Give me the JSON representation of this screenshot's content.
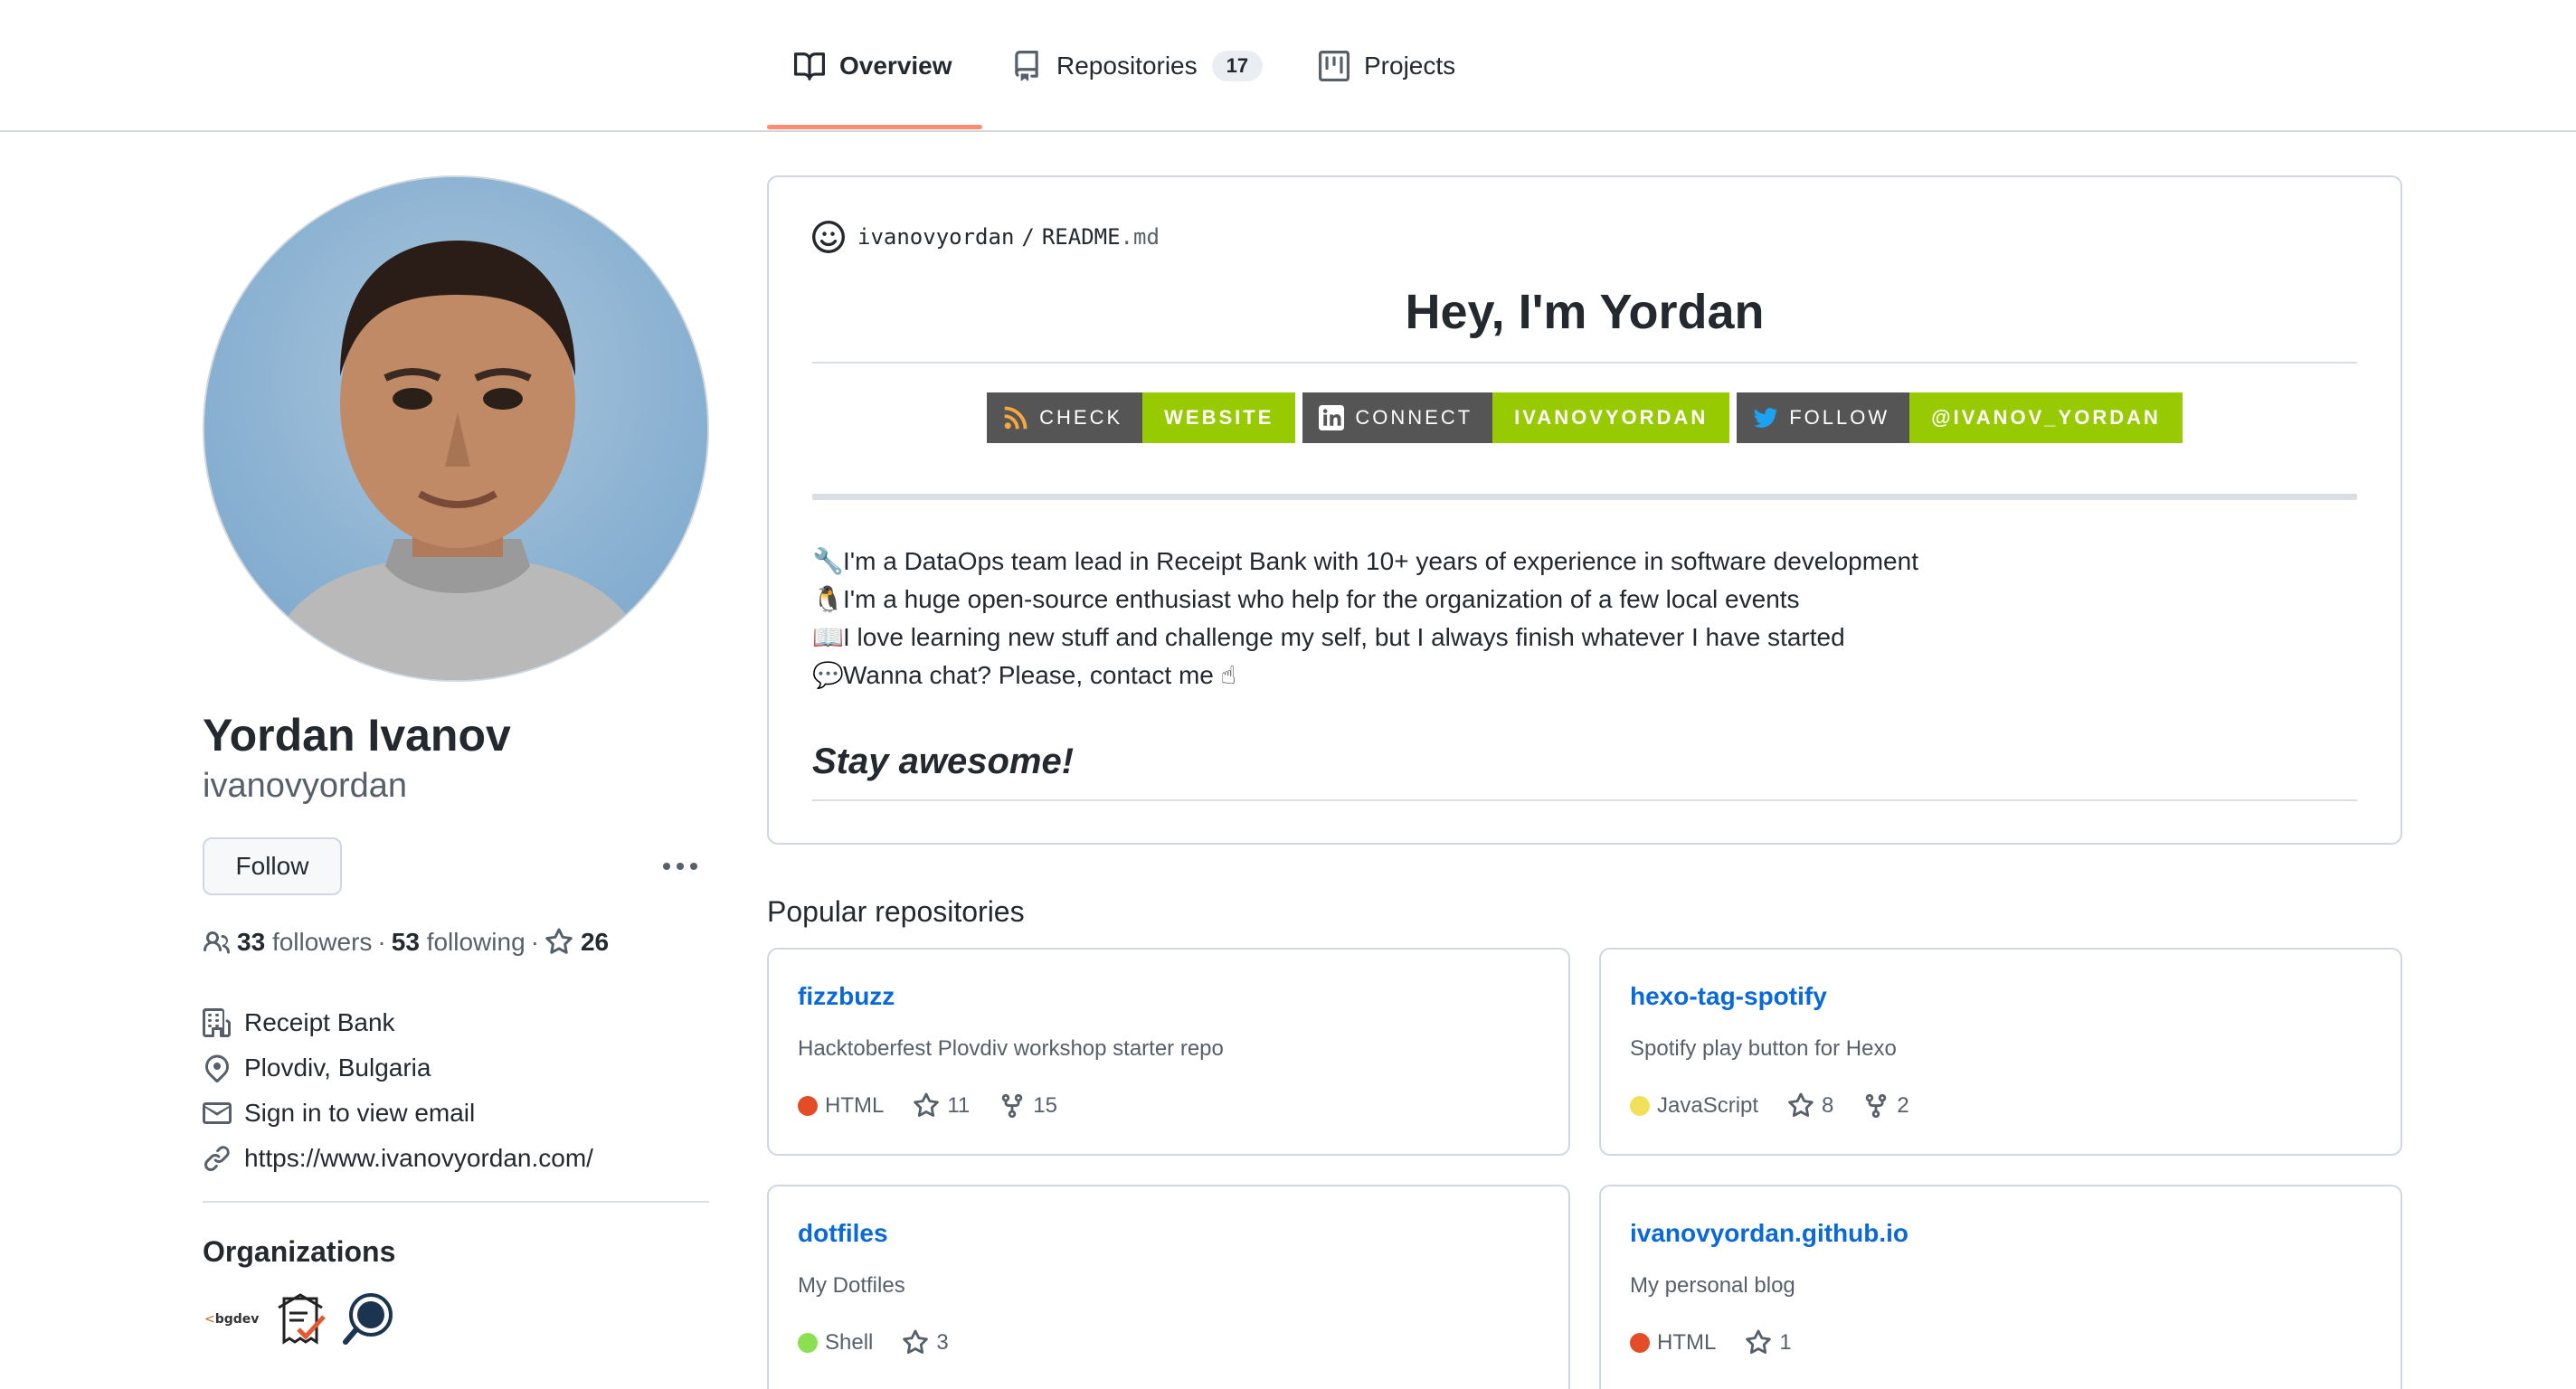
{
  "nav": {
    "tabs": [
      {
        "label": "Overview",
        "icon": "book-icon",
        "active": true
      },
      {
        "label": "Repositories",
        "icon": "repo-icon",
        "count": "17"
      },
      {
        "label": "Projects",
        "icon": "project-icon"
      }
    ]
  },
  "profile": {
    "name": "Yordan Ivanov",
    "login": "ivanovyordan",
    "follow_label": "Follow",
    "followers": "33",
    "followers_label": "followers",
    "following": "53",
    "following_label": "following",
    "stars": "26",
    "company": "Receipt Bank",
    "location": "Plovdiv, Bulgaria",
    "email": "Sign in to view email",
    "website": "https://www.ivanovyordan.com/",
    "organizations_title": "Organizations",
    "organizations": [
      "bgdev",
      "receipt-org",
      "search-org"
    ]
  },
  "readme": {
    "owner": "ivanovyordan",
    "sep": "/",
    "file": "README",
    "ext": ".md",
    "title": "Hey, I'm Yordan",
    "badges": [
      {
        "left": "CHECK",
        "right": "WEBSITE",
        "icon": "rss-icon"
      },
      {
        "left": "CONNECT",
        "right": "IVANOVYORDAN",
        "icon": "linkedin-icon"
      },
      {
        "left": "FOLLOW",
        "right": "@IVANOV_YORDAN",
        "icon": "twitter-icon"
      }
    ],
    "bio": [
      {
        "emoji": "🔧",
        "text": "I'm a DataOps team lead in Receipt Bank with 10+ years of experience in software development"
      },
      {
        "emoji": "🐧",
        "text": "I'm a huge open-source enthusiast who help for the organization of a few local events"
      },
      {
        "emoji": "📖",
        "text": "I love learning new stuff and challenge my self, but I always finish whatever I have started"
      },
      {
        "emoji": "💬",
        "text": "Wanna chat? Please, contact me ☝"
      }
    ],
    "closing": "Stay awesome!"
  },
  "popular": {
    "title": "Popular repositories",
    "repos": [
      {
        "name": "fizzbuzz",
        "desc": "Hacktoberfest Plovdiv workshop starter repo",
        "lang": "HTML",
        "lang_color": "#e34c26",
        "stars": "11",
        "forks": "15"
      },
      {
        "name": "hexo-tag-spotify",
        "desc": "Spotify play button for Hexo",
        "lang": "JavaScript",
        "lang_color": "#f1e05a",
        "stars": "8",
        "forks": "2"
      },
      {
        "name": "dotfiles",
        "desc": "My Dotfiles",
        "lang": "Shell",
        "lang_color": "#89e051",
        "stars": "3",
        "forks": ""
      },
      {
        "name": "ivanovyordan.github.io",
        "desc": "My personal blog",
        "lang": "HTML",
        "lang_color": "#e34c26",
        "stars": "1",
        "forks": ""
      }
    ]
  }
}
